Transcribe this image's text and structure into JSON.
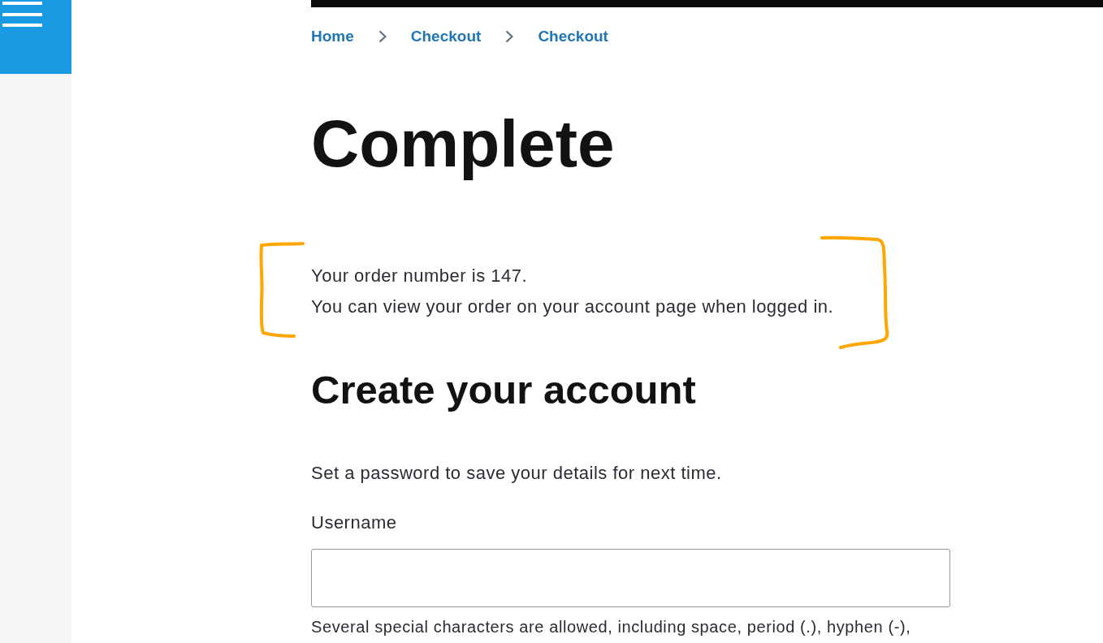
{
  "breadcrumb": [
    {
      "label": "Home"
    },
    {
      "label": "Checkout"
    },
    {
      "label": "Checkout"
    }
  ],
  "title": "Complete",
  "order_messages": [
    "Your order number is 147.",
    "You can view your order on your account page when logged in."
  ],
  "account": {
    "heading": "Create your account",
    "intro": "Set a password to save your details for next time.",
    "username": {
      "label": "Username",
      "help": "Several special characters are allowed, including space, period (.), hyphen (-),"
    }
  }
}
